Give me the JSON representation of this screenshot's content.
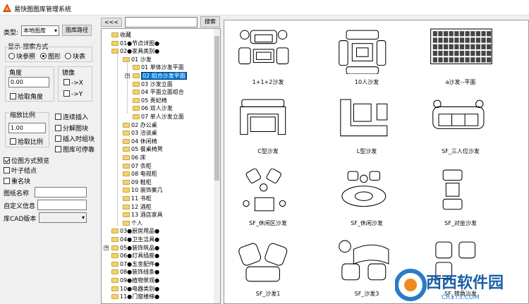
{
  "window": {
    "title": "易快图图库管理系统"
  },
  "left": {
    "type_label": "类型:",
    "type_value": "本地图库",
    "path_button": "图库路径",
    "display_label": "显示-搜索方式",
    "radio_block": "块参照",
    "radio_image": "图形",
    "radio_table": "块表",
    "angle_label": "角度",
    "angle_value": "0.00",
    "pick_angle": "拾取角度",
    "mirror_label": "镜像",
    "mirror_x": "->X",
    "mirror_y": "->Y",
    "scale_label": "缩放比例",
    "scale_value": "1.00",
    "pick_scale": "拾取比例",
    "continuous_insert": "连续插入",
    "explode_block": "分解图块",
    "insert_as_block": "插入时组块",
    "library_dockable": "图库可停靠",
    "bitmap_preview": "位图方式预览",
    "leaf_node": "叶子结点",
    "rename_block": "重名块",
    "drawing_name": "图纸名称",
    "custom_info": "自定义信息",
    "cad_version": "库CAD版本"
  },
  "nav": {
    "back": "<<<",
    "search_placeholder": "",
    "search_button": "搜索"
  },
  "tree": [
    {
      "label": "收藏",
      "indent": 0
    },
    {
      "label": "01●节点详图●",
      "indent": 0
    },
    {
      "label": "02●家具类别●",
      "indent": 0
    },
    {
      "label": "01 沙发",
      "indent": 1
    },
    {
      "label": "01 单体沙发平面",
      "indent": 2
    },
    {
      "label": "02 组合沙发平面",
      "indent": 2,
      "selected": true
    },
    {
      "label": "03 沙发立面",
      "indent": 2
    },
    {
      "label": "04 平面立面组合",
      "indent": 2
    },
    {
      "label": "05 贵妃椅",
      "indent": 2
    },
    {
      "label": "06 双人沙发",
      "indent": 2
    },
    {
      "label": "07 单人沙发立面",
      "indent": 2
    },
    {
      "label": "02 办公桌",
      "indent": 1
    },
    {
      "label": "03 洽谈桌",
      "indent": 1
    },
    {
      "label": "04 休闲椅",
      "indent": 1
    },
    {
      "label": "05 餐桌椅凳",
      "indent": 1
    },
    {
      "label": "06 床",
      "indent": 1
    },
    {
      "label": "07 衣柜",
      "indent": 1
    },
    {
      "label": "08 电视柜",
      "indent": 1
    },
    {
      "label": "09 鞋柜",
      "indent": 1
    },
    {
      "label": "10 装饰案几",
      "indent": 1
    },
    {
      "label": "11 书柜",
      "indent": 1
    },
    {
      "label": "12 酒柜",
      "indent": 1
    },
    {
      "label": "13 酒店家具",
      "indent": 1
    },
    {
      "label": "个人",
      "indent": 1
    },
    {
      "label": "03●厨房用品●",
      "indent": 0
    },
    {
      "label": "04●卫生洁具●",
      "indent": 0
    },
    {
      "label": "05●装饰筑品●",
      "indent": 0
    },
    {
      "label": "06●灯具插座●",
      "indent": 0
    },
    {
      "label": "07●五金配件●",
      "indent": 0
    },
    {
      "label": "08●装饰线条●",
      "indent": 0
    },
    {
      "label": "09●植物景观●",
      "indent": 0
    },
    {
      "label": "10●电器类别●",
      "indent": 0
    },
    {
      "label": "11●门窗楼梯●",
      "indent": 0
    }
  ],
  "previews": [
    "1+1+2沙发",
    "10人沙发",
    "a沙发--平面",
    "C型沙发",
    "L型沙发",
    "SF_三人位沙发",
    "SF_休闲区沙发",
    "SF_休闲沙发",
    "SF_对坐沙发",
    "SF_沙发1",
    "SF_沙发3",
    "SF_转角沙发"
  ],
  "watermark": {
    "brand": "西西软件园",
    "url": "CR173.COM"
  }
}
